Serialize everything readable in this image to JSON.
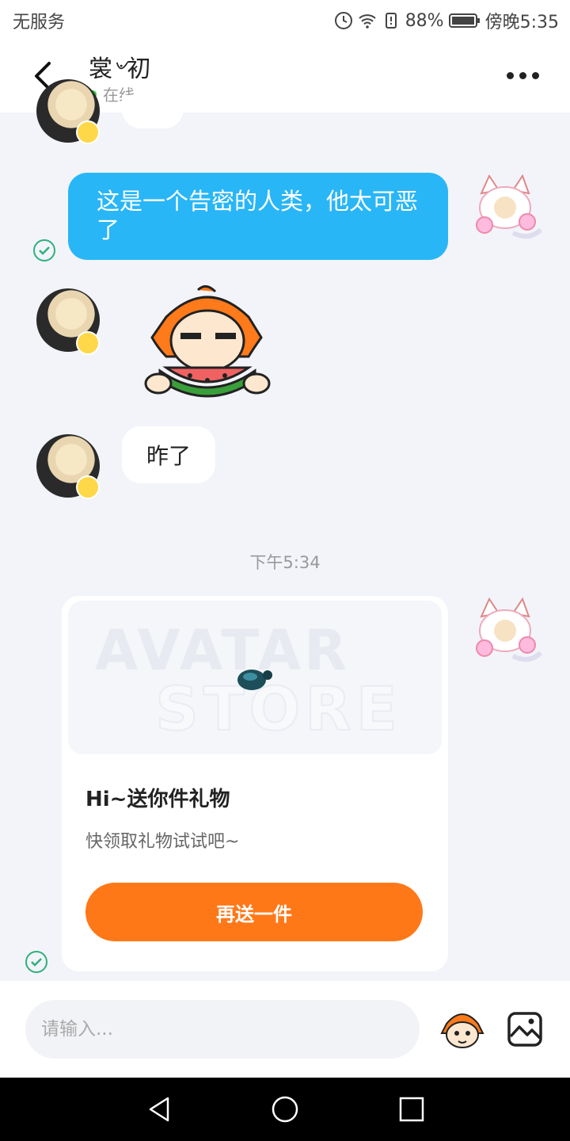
{
  "status_bar": {
    "carrier": "无服务",
    "battery": "88%",
    "time": "傍晚5:35"
  },
  "header": {
    "contact_name": "裳৺初",
    "status": "在线"
  },
  "messages": {
    "out1": "这是一个告密的人类，他太可恶了",
    "in_text": "昨了",
    "timestamp": "下午5:34"
  },
  "gift_card": {
    "watermark_line1": "AVATAR",
    "watermark_line2": "STORE",
    "title": "Hi~送你件礼物",
    "subtitle": "快领取礼物试试吧~",
    "button": "再送一件"
  },
  "input": {
    "placeholder": "请输入..."
  },
  "colors": {
    "accent_blue": "#29b6f6",
    "accent_orange": "#ff7818",
    "online_green": "#2ecc40"
  }
}
